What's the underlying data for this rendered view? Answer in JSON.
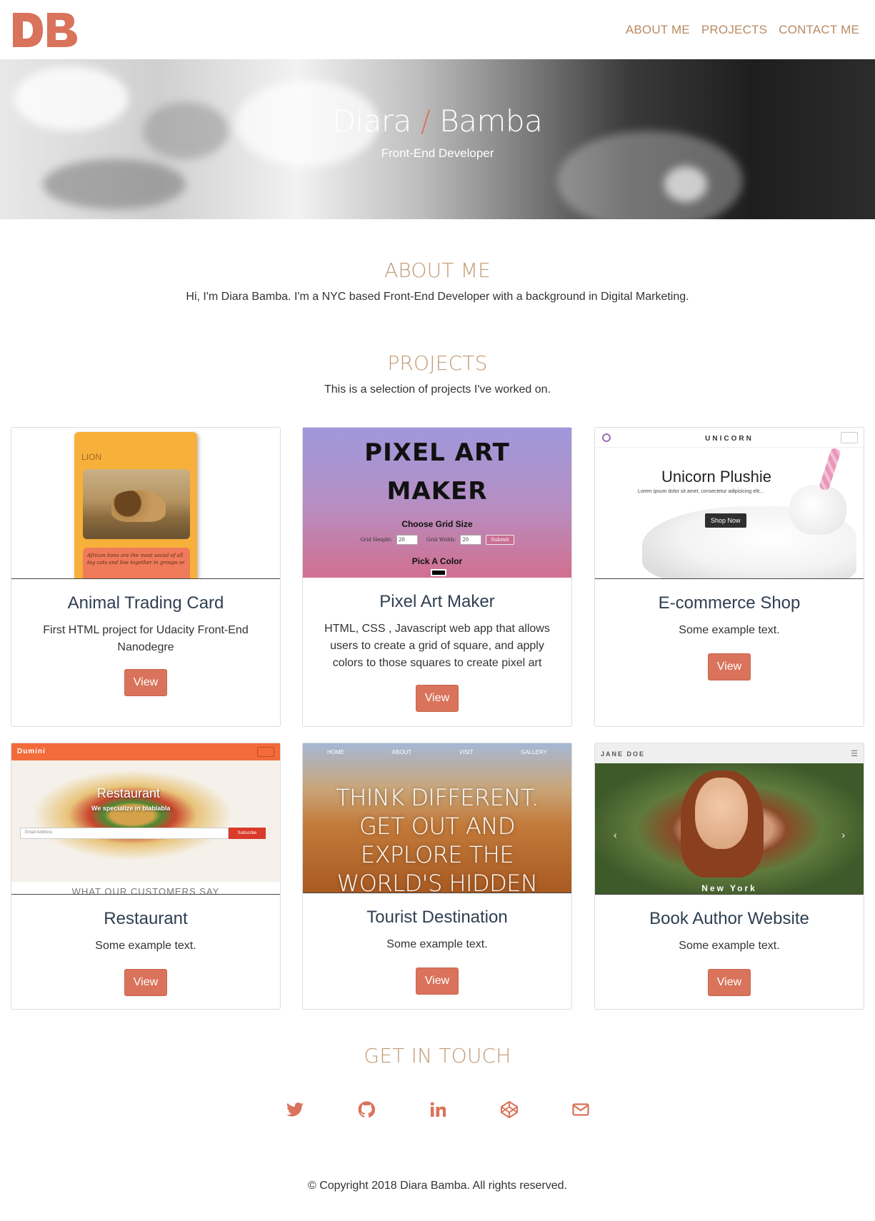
{
  "logo": {
    "text": "DB",
    "color": "#d9735b"
  },
  "nav": {
    "items": [
      "ABOUT ME",
      "PROJECTS",
      "CONTACT ME"
    ]
  },
  "hero": {
    "first_name": "Diara",
    "separator": "/",
    "last_name": "Bamba",
    "subtitle": "Front-End Developer"
  },
  "about": {
    "title": "ABOUT ME",
    "text": "Hi, I'm Diara Bamba. I'm a NYC based Front-End Developer with a background in Digital Marketing."
  },
  "projects": {
    "title": "PROJECTS",
    "intro": "This is a selection of projects I've worked on.",
    "items": [
      {
        "title": "Animal Trading Card",
        "text": "First HTML project for Udacity Front-End Nanodegre",
        "button": "View",
        "thumb": {
          "label": "LION",
          "desc": "African lions are the most social of all big cats and live together in groups or"
        }
      },
      {
        "title": "Pixel Art Maker",
        "text": "HTML, CSS , Javascript web app that allows users to create a grid of square, and apply colors to those squares to create pixel art",
        "button": "View",
        "thumb": {
          "title_line1": "PIXEL ART",
          "title_line2": "MAKER",
          "grid_label": "Choose Grid Size",
          "height_label": "Grid Height:",
          "height_value": "20",
          "width_label": "Grid Width:",
          "width_value": "20",
          "submit": "Submit",
          "color_label": "Pick A Color"
        }
      },
      {
        "title": "E-commerce Shop",
        "text": "Some example text.",
        "button": "View",
        "thumb": {
          "brand": "UNICORN",
          "heading": "Unicorn Plushie",
          "lorem": "Lorem ipsum dolor sit amet, consectetur adipisicing elit...",
          "cta": "Shop Now"
        }
      },
      {
        "title": "Restaurant",
        "text": "Some example text.",
        "button": "View",
        "thumb": {
          "brand": "Dumini",
          "heading": "Restaurant",
          "sub": "We specialize in blablabla",
          "input_placeholder": "Email Address",
          "subscribe": "Subscribe",
          "bottom": "WHAT OUR CUSTOMERS SAY"
        }
      },
      {
        "title": "Tourist Destination",
        "text": "Some example text.",
        "button": "View",
        "thumb": {
          "nav": [
            "HOME",
            "ABOUT",
            "VISIT",
            "GALLERY"
          ],
          "line1": "THINK DIFFERENT.",
          "line2": "GET OUT AND",
          "line3": "EXPLORE THE",
          "line4": "WORLD'S HIDDEN"
        }
      },
      {
        "title": "Book Author Website",
        "text": "Some example text.",
        "button": "View",
        "thumb": {
          "brand": "JANE DOE",
          "caption": "New York"
        }
      }
    ]
  },
  "contact": {
    "title": "GET IN TOUCH",
    "icons": [
      "twitter-icon",
      "github-icon",
      "linkedin-icon",
      "codepen-icon",
      "envelope-icon"
    ],
    "icon_color": "#d9735b"
  },
  "footer": {
    "copyright": "© Copyright 2018 Diara Bamba. All rights reserved."
  }
}
